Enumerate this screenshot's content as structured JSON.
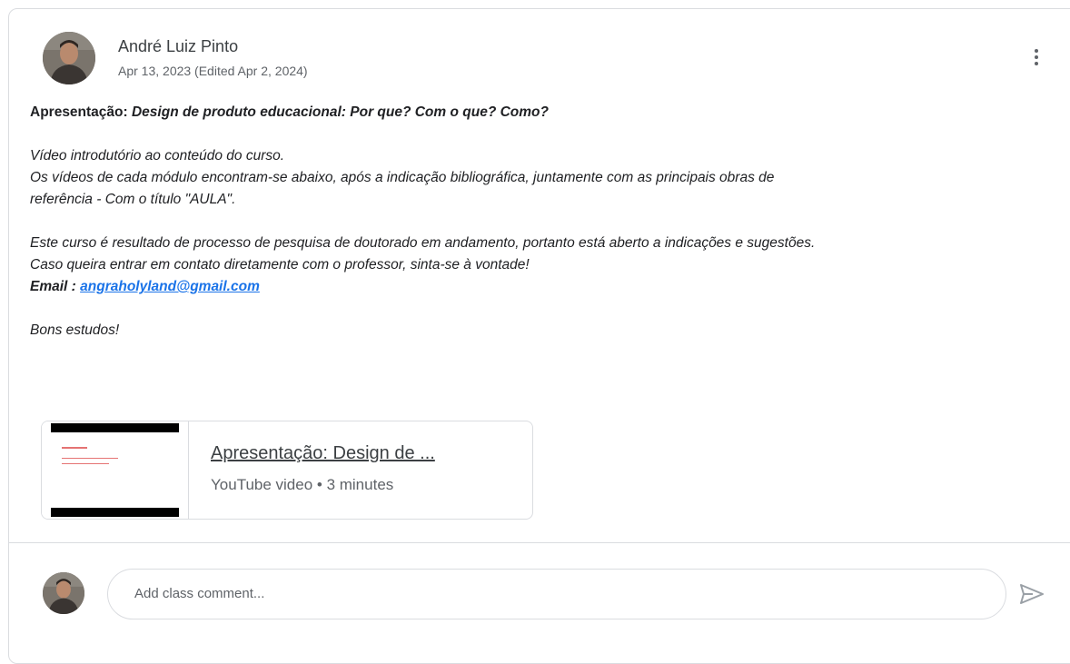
{
  "post": {
    "author": "André Luiz Pinto",
    "date": "Apr 13, 2023 (Edited Apr 2, 2024)",
    "title_prefix": "Apresentação: ",
    "title_italic": "Design de produto educacional: Por que? Com o que? Como?",
    "line1": "Vídeo introdutório ao conteúdo do curso.",
    "line2": "Os vídeos de cada módulo encontram-se abaixo, após a indicação bibliográfica, juntamente com as principais obras de",
    "line3": "referência - Com o título \"AULA\".",
    "line4": "Este curso é resultado de processo de pesquisa de doutorado em andamento, portanto está aberto a indicações e sugestões.",
    "line5": "Caso queira entrar em contato diretamente com o professor, sinta-se à vontade!",
    "email_label": "Email : ",
    "email": "angraholyland@gmail.com",
    "closing": "Bons estudos!"
  },
  "attachment": {
    "title": "Apresentação: Design de ...",
    "subtitle": "YouTube video • 3 minutes"
  },
  "comment": {
    "placeholder": "Add class comment..."
  },
  "icons": {
    "more": "more-vert-icon",
    "send": "send-icon"
  },
  "colors": {
    "link": "#1a73e8",
    "border": "#dadce0",
    "muted": "#5f6368"
  }
}
